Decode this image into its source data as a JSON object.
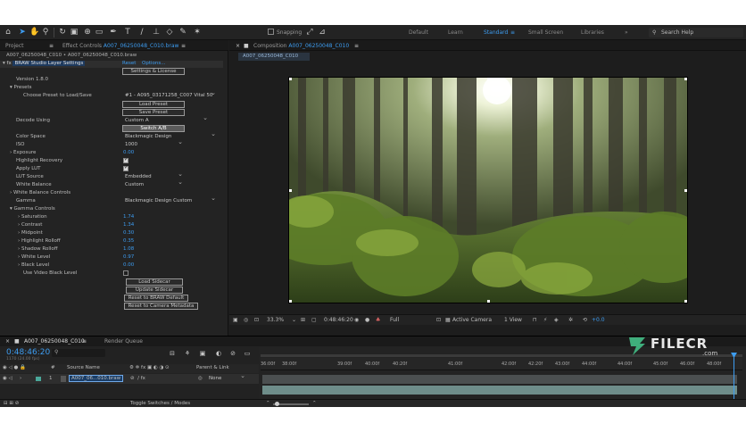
{
  "toolbar": {
    "snapping_label": "Snapping",
    "workspaces": [
      "Default",
      "Learn",
      "Standard",
      "Small Screen",
      "Libraries"
    ],
    "active_workspace": "Standard",
    "search_placeholder": "Search Help"
  },
  "left_panel": {
    "tab_project": "Project",
    "tab_effect_controls_prefix": "Effect Controls",
    "tab_effect_controls_layer": "A007_06250048_C010.braw",
    "layer_path": "A007_06250048_C010 • A007_06250048_C010.braw",
    "effect_name": "BRAW Studio Layer Settings",
    "reset_label": "Reset",
    "options_label": "Options...",
    "settings_license_button": "Settings & License",
    "version": "Version 1.8.0",
    "presets_label": "Presets",
    "choose_preset_label": "Choose Preset to Load/Save",
    "preset_value": "#1 - A095_03171258_C007 Vital 50",
    "load_preset_button": "Load Preset",
    "save_preset_button": "Save Preset",
    "decode_using_label": "Decode Using",
    "decode_using_value": "Custom A",
    "switch_ab_button": "Switch A/B",
    "color_space_label": "Color Space",
    "color_space_value": "Blackmagic Design",
    "iso_label": "ISO",
    "iso_value": "1000",
    "exposure_label": "Exposure",
    "exposure_value": "0.00",
    "highlight_recovery_label": "Highlight Recovery",
    "apply_lut_label": "Apply LUT",
    "lut_source_label": "LUT Source",
    "lut_source_value": "Embedded",
    "white_balance_label": "White Balance",
    "white_balance_value": "Custom",
    "white_balance_controls_label": "White Balance Controls",
    "gamma_label": "Gamma",
    "gamma_value": "Blackmagic Design Custom",
    "gamma_controls_label": "Gamma Controls",
    "gamma_params": [
      {
        "label": "Saturation",
        "value": "1.74"
      },
      {
        "label": "Contrast",
        "value": "1.34"
      },
      {
        "label": "Midpoint",
        "value": "0.30"
      },
      {
        "label": "Highlight Rolloff",
        "value": "0.35"
      },
      {
        "label": "Shadow Rolloff",
        "value": "1.08"
      },
      {
        "label": "White Level",
        "value": "0.97"
      },
      {
        "label": "Black Level",
        "value": "0.00"
      }
    ],
    "use_video_black_level_label": "Use Video Black Level",
    "load_sidecar_button": "Load Sidecar",
    "update_sidecar_button": "Update Sidecar",
    "reset_braw_default_button": "Reset to BRAW Default",
    "reset_camera_metadata_button": "Reset to Camera Metadata"
  },
  "composition": {
    "tab_prefix": "Composition",
    "tab_name": "A007_06250048_C010",
    "sub_tab": "A007_06250048_C010",
    "zoom": "33.3%",
    "timecode": "0:48:46:20",
    "resolution": "Full",
    "camera": "Active Camera",
    "views": "1 View",
    "exposure": "+0.0"
  },
  "timeline": {
    "tab_name": "A007_06250048_C010",
    "render_queue_label": "Render Queue",
    "timecode": "0:48:46:20",
    "frame_info": "1170 (24.00 fps)",
    "source_name_header": "Source Name",
    "parent_link_header": "Parent & Link",
    "layer_number": "1",
    "layer_name": "A007_06...010.braw",
    "parent_value": "None",
    "toggle_label": "Toggle Switches / Modes",
    "ruler_ticks": [
      "36:00f",
      "38:00f",
      "39:00f",
      "40:00f",
      "40:20f",
      "41:00f",
      "42:00f",
      "42:20f",
      "43:00f",
      "44:00f",
      "44:00f",
      "45:00f",
      "46:00f",
      "48:00f"
    ]
  },
  "watermark": {
    "brand": "FILECR",
    "suffix": ".com"
  }
}
